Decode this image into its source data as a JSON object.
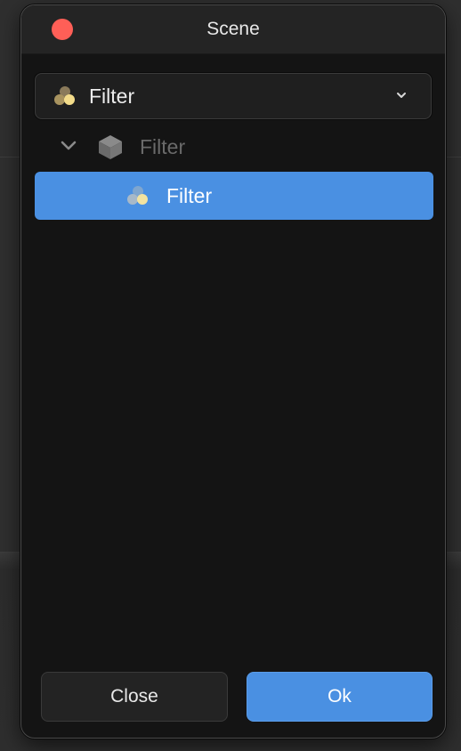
{
  "window": {
    "title": "Scene"
  },
  "dropdown": {
    "icon": "filter-icon",
    "selected_label": "Filter"
  },
  "tree": {
    "parent": {
      "icon": "cube-icon",
      "label": "Filter",
      "expanded": true
    },
    "selected_child": {
      "icon": "filter-icon",
      "label": "Filter"
    }
  },
  "buttons": {
    "close_label": "Close",
    "ok_label": "Ok"
  },
  "colors": {
    "accent": "#4a90e2",
    "close_dot": "#ff5f57",
    "window_bg": "#141414"
  }
}
